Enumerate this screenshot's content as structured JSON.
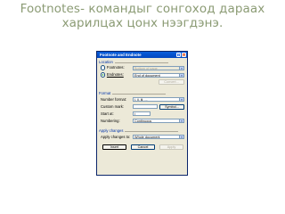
{
  "slide": {
    "title_line1": "Footnotes- командыг сонгоход дараах",
    "title_line2": "харилцах цонх нээгдэнэ."
  },
  "dialog": {
    "title": "Footnote and Endnote",
    "help_glyph": "?",
    "close_glyph": "×",
    "location": {
      "section_label": "Location",
      "footnotes_label": "Footnotes:",
      "footnotes_value": "Bottom of page",
      "endnotes_label": "Endnotes:",
      "endnotes_value": "End of document",
      "endnotes_selected": true,
      "convert_button": "Convert..."
    },
    "format": {
      "section_label": "Format",
      "number_format_label": "Number format:",
      "number_format_value": "i, ii, iii, ...",
      "custom_mark_label": "Custom mark:",
      "custom_mark_value": "",
      "symbol_button": "Symbol...",
      "start_at_label": "Start at:",
      "start_at_value": "i",
      "numbering_label": "Numbering:",
      "numbering_value": "Continuous"
    },
    "apply": {
      "section_label": "Apply changes",
      "apply_to_label": "Apply changes to:",
      "apply_to_value": "Whole document",
      "insert_button": "Insert",
      "cancel_button": "Cancel",
      "apply_button": "Apply"
    },
    "dropdown_glyph": "▼"
  }
}
